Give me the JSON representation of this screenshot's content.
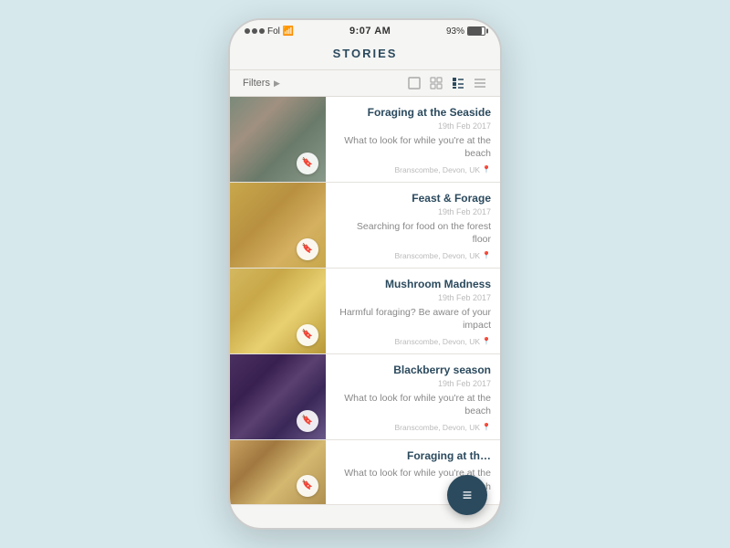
{
  "statusBar": {
    "carrier": "Fol",
    "time": "9:07 AM",
    "battery": "93%",
    "signal": "●●●"
  },
  "header": {
    "title": "STORIES"
  },
  "toolbar": {
    "filtersLabel": "Filters",
    "viewIcons": [
      "single",
      "grid",
      "list",
      "compact"
    ]
  },
  "stories": [
    {
      "id": 1,
      "title": "Foraging at the Seaside",
      "date": "19th Feb 2017",
      "description": "What to look for while you're at the beach",
      "location": "Branscombe, Devon, UK",
      "imgClass": "img-seaside"
    },
    {
      "id": 2,
      "title": "Feast & Forage",
      "date": "19th Feb 2017",
      "description": "Searching for food on the forest floor",
      "location": "Branscombe, Devon, UK",
      "imgClass": "img-feast"
    },
    {
      "id": 3,
      "title": "Mushroom Madness",
      "date": "19th Feb 2017",
      "description": "Harmful foraging? Be aware of your impact",
      "location": "Branscombe, Devon, UK",
      "imgClass": "img-mushroom"
    },
    {
      "id": 4,
      "title": "Blackberry season",
      "date": "19th Feb 2017",
      "description": "What to look for while you're at the beach",
      "location": "Branscombe, Devon, UK",
      "imgClass": "img-blackberry"
    },
    {
      "id": 5,
      "title": "Foraging at th…",
      "date": "",
      "description": "What to look for while you're at the beach",
      "location": "",
      "imgClass": "img-foraging2"
    }
  ],
  "fab": {
    "icon": "≡",
    "label": "menu"
  }
}
